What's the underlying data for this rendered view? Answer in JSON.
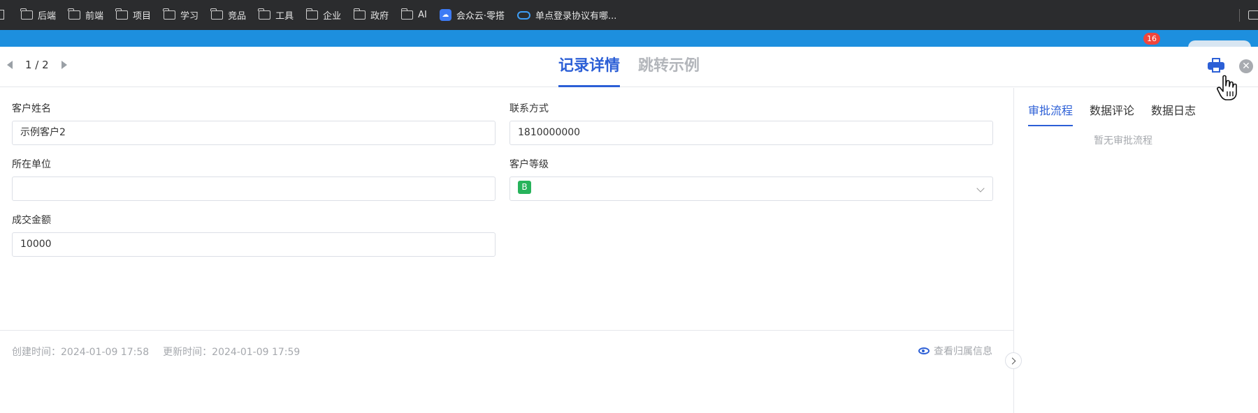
{
  "bookmarks": [
    {
      "label": "后端",
      "icon": "folder-icon"
    },
    {
      "label": "前端",
      "icon": "folder-icon"
    },
    {
      "label": "项目",
      "icon": "folder-icon"
    },
    {
      "label": "学习",
      "icon": "folder-icon"
    },
    {
      "label": "竞品",
      "icon": "folder-icon"
    },
    {
      "label": "工具",
      "icon": "folder-icon"
    },
    {
      "label": "企业",
      "icon": "folder-icon"
    },
    {
      "label": "政府",
      "icon": "folder-icon"
    },
    {
      "label": "AI",
      "icon": "folder-icon"
    },
    {
      "label": "会众云·零搭",
      "icon": "cloud-app-icon"
    },
    {
      "label": "单点登录协议有哪...",
      "icon": "cloud-outline-icon"
    }
  ],
  "app": {
    "notification_count": "16"
  },
  "modal": {
    "pager": "1 / 2",
    "tabs": [
      {
        "label": "记录详情",
        "active": true
      },
      {
        "label": "跳转示例",
        "active": false
      }
    ],
    "close_symbol": "✕"
  },
  "form": {
    "customer_name": {
      "label": "客户姓名",
      "value": "示例客户2"
    },
    "contact": {
      "label": "联系方式",
      "value": "1810000000"
    },
    "company": {
      "label": "所在单位",
      "value": ""
    },
    "level": {
      "label": "客户等级",
      "value": "B",
      "color": "#27b35b"
    },
    "amount": {
      "label": "成交金额",
      "value": "10000"
    }
  },
  "meta": {
    "created": "创建时间：2024-01-09 17:58",
    "updated": "更新时间：2024-01-09 17:59",
    "owner_link": "查看归属信息"
  },
  "side": {
    "tabs": [
      {
        "label": "审批流程",
        "active": true
      },
      {
        "label": "数据评论",
        "active": false
      },
      {
        "label": "数据日志",
        "active": false
      }
    ],
    "empty_text": "暂无审批流程"
  },
  "colors": {
    "accent": "#2c5fd6",
    "bookmark_bar": "#2b2c2e",
    "app_header": "#1d8fde"
  }
}
